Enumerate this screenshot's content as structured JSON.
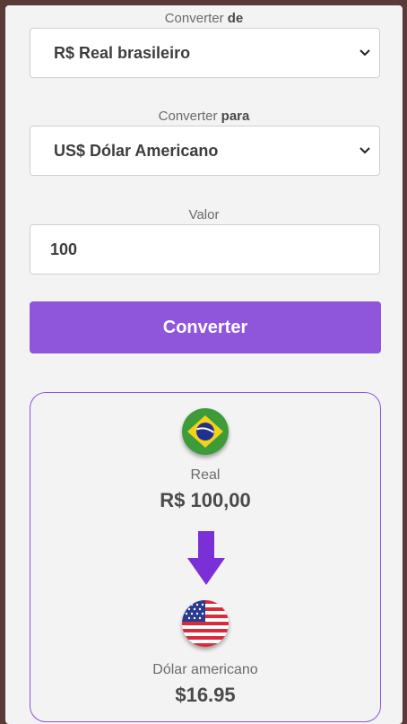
{
  "from": {
    "label_prefix": "Converter",
    "label_strong": "de",
    "selected": "R$ Real brasileiro"
  },
  "to": {
    "label_prefix": "Converter",
    "label_strong": "para",
    "selected": "US$ Dólar Americano"
  },
  "amount": {
    "label": "Valor",
    "value": "100"
  },
  "convert_button": {
    "label": "Converter"
  },
  "result": {
    "source": {
      "name": "Real",
      "formatted": "R$ 100,00",
      "flag_icon": "brazil-flag-icon"
    },
    "target": {
      "name": "Dólar americano",
      "formatted": "$16.95",
      "flag_icon": "usa-flag-icon"
    },
    "arrow_icon": "arrow-down-icon"
  },
  "colors": {
    "accent": "#8f55da",
    "arrow": "#7b2fd6",
    "card_bg": "#f3f3f3",
    "page_bg": "#5a3a36"
  }
}
